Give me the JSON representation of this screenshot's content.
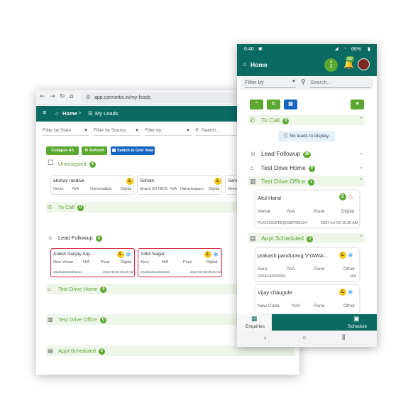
{
  "browser": {
    "url": "app.convertix.in/my-leads",
    "breadcrumb_home": "Home",
    "breadcrumb_current": "My Leads",
    "filters": [
      "Filter by State",
      "Filter by Source",
      "Filter by"
    ],
    "search_placeholder": "Search...",
    "collapse_all": "Collapse All",
    "refresh": "Refresh",
    "grid_view": "Switch to Grid View",
    "sections": {
      "unassigned": {
        "label": "Unassigned",
        "count": "4"
      },
      "to_call": {
        "label": "To Call",
        "count": "0"
      },
      "lead_followup": {
        "label": "Lead Followup",
        "count": "2"
      },
      "test_drive_home": {
        "label": "Test Drive Home",
        "count": "0"
      },
      "test_drive_office": {
        "label": "Test Drive Office",
        "count": "0"
      },
      "appt_scheduled": {
        "label": "Appt Scheduled",
        "count": "0"
      }
    },
    "unassigned_cards": [
      {
        "name": "akshay randive",
        "badge": "L",
        "model": "Verna",
        "variant": "N/A",
        "city": "Osmanabad",
        "source": "Digital"
      },
      {
        "name": "Soham",
        "badge": "L",
        "model": "Grand I10 NIOS",
        "variant": "N/A",
        "city": "Narayangaon",
        "source": "Digital"
      },
      {
        "name": "Sanch",
        "model": "Venue"
      }
    ],
    "followup_cards": [
      {
        "name": "Aniket Sanjay Arg...",
        "badge": "L",
        "model": "New Venue",
        "variant": "N/A",
        "city": "Pune",
        "source": "Digital",
        "id": "2024/LD/JUN/01014",
        "date": "2024-08-09 09:30 AM"
      },
      {
        "name": "Ankit Nagar",
        "badge": "L",
        "model": "Aura",
        "variant": "N/A",
        "city": "Pune",
        "source": "Digital",
        "id": "2024/LD/JUN/01019",
        "date": "2024-08-09 09:30 AM"
      }
    ]
  },
  "phone": {
    "time": "6:40",
    "battery": "66%",
    "home": "Home",
    "notif_count": "227",
    "filter_placeholder": "Filter by",
    "search_placeholder": "Search...",
    "no_leads": "No leads to display.",
    "sections": {
      "to_call": {
        "label": "To Call",
        "count": "0"
      },
      "lead_followup": {
        "label": "Lead Followup",
        "count": "30"
      },
      "test_drive_home": {
        "label": "Test Drive Home",
        "count": "0"
      },
      "test_drive_office": {
        "label": "Test Drive Office",
        "count": "1"
      },
      "appt_scheduled": {
        "label": "Appt Scheduled",
        "count": "3"
      }
    },
    "office_card": {
      "name": "Atul Haral",
      "badge": "E",
      "model": "Venue",
      "variant": "N/A",
      "city": "Pune",
      "source": "Digital",
      "id": "PU/SH/2024/EQ/SEP/05334",
      "date": "2024-10-03 11:30 AM"
    },
    "appt_cards": [
      {
        "name": "prakash pandurang VYAWA...",
        "badge": "L",
        "model": "Aura",
        "variant": "N/A",
        "city": "Pune",
        "source": "Other",
        "id": "2024/HO/00004",
        "extra": "N/A"
      },
      {
        "name": "Vijay chaugule",
        "badge": "L",
        "model": "New Creta",
        "variant": "N/A",
        "city": "Pune",
        "source": "Other"
      }
    ],
    "tab_enquiries": "Enquiries",
    "tab_schedule": "Schedule",
    "colors": {
      "teal": "#0b6b63",
      "green": "#5aa830",
      "blue": "#1565c0",
      "red": "#d7263d",
      "yellow": "#f5c518"
    }
  }
}
